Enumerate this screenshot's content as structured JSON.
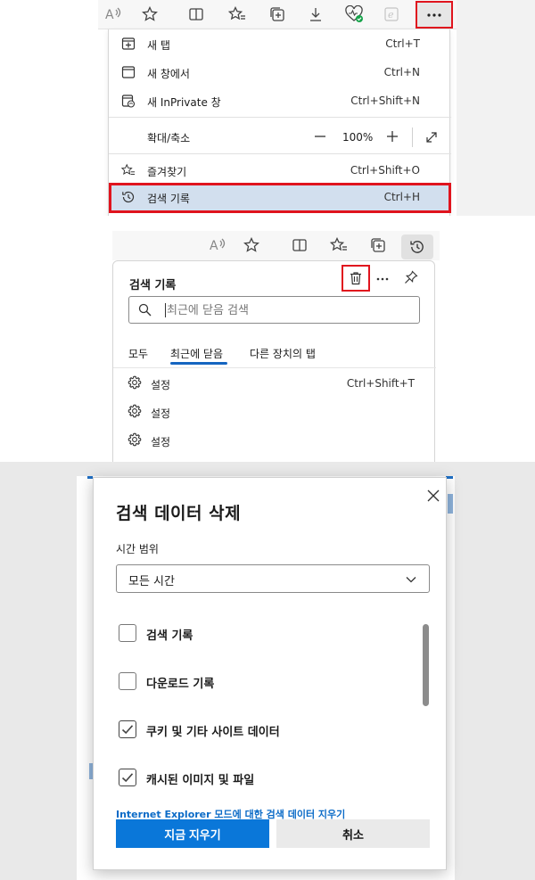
{
  "menu": {
    "items": [
      {
        "label": "새 탭",
        "shortcut": "Ctrl+T"
      },
      {
        "label": "새 창에서",
        "shortcut": "Ctrl+N"
      },
      {
        "label": "새 InPrivate 창",
        "shortcut": "Ctrl+Shift+N"
      }
    ],
    "zoom": {
      "label": "확대/축소",
      "value": "100%"
    },
    "favorites": {
      "label": "즐겨찾기",
      "shortcut": "Ctrl+Shift+O"
    },
    "history": {
      "label": "검색 기록",
      "shortcut": "Ctrl+H"
    }
  },
  "history_hub": {
    "title": "검색 기록",
    "search_placeholder": "최근에 닫음 검색",
    "tabs": [
      "모두",
      "최근에 닫음",
      "다른 장치의 탭"
    ],
    "active_tab": 1,
    "items": [
      {
        "label": "설정",
        "shortcut": "Ctrl+Shift+T"
      },
      {
        "label": "설정",
        "shortcut": ""
      },
      {
        "label": "설정",
        "shortcut": ""
      }
    ]
  },
  "clear_dialog": {
    "title": "검색 데이터 삭제",
    "range_label": "시간 범위",
    "range_value": "모든 시간",
    "options": [
      {
        "label": "검색 기록",
        "checked": false
      },
      {
        "label": "다운로드 기록",
        "checked": false
      },
      {
        "label": "쿠키 및 기타 사이트 데이터",
        "checked": true
      },
      {
        "label": "캐시된 이미지 및 파일",
        "checked": true
      }
    ],
    "ie_link": "Internet Explorer 모드에 대한 검색 데이터 지우기",
    "clear_button": "지금 지우기",
    "cancel_button": "취소"
  },
  "colors": {
    "highlight_border": "#e0141e",
    "menu_highlight": "#d2dfee",
    "accent_blue": "#0a77d9",
    "link_blue": "#0b6bc7"
  }
}
